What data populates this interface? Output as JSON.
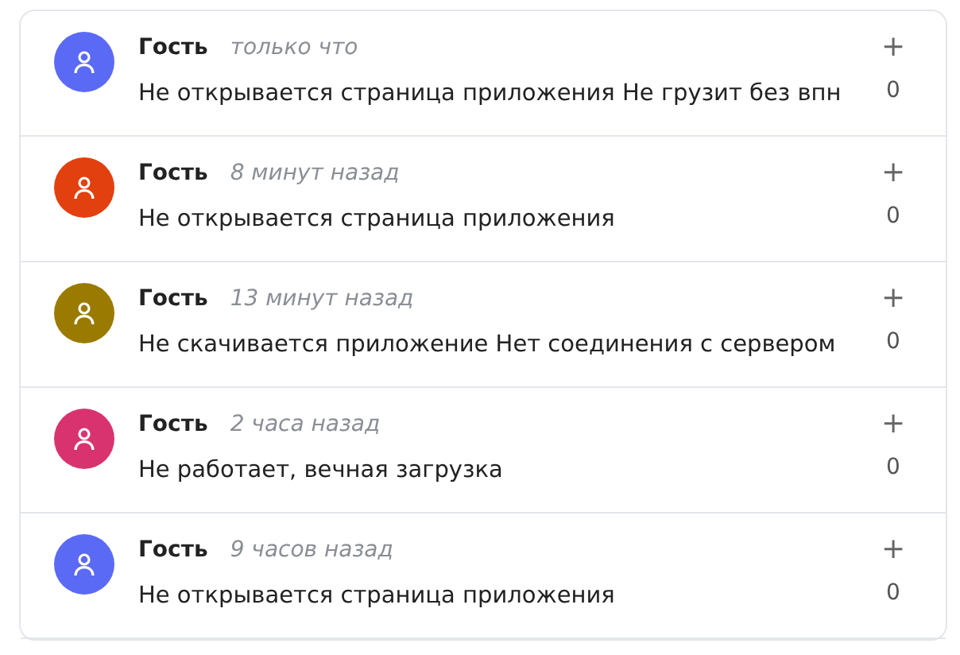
{
  "comments": [
    {
      "author": "Гость",
      "time": "только что",
      "text": "Не открывается страница приложения Не грузит без впн",
      "plus": "+",
      "votes": "0",
      "color": "#5b6af5"
    },
    {
      "author": "Гость",
      "time": "8 минут назад",
      "text": "Не открывается страница приложения",
      "plus": "+",
      "votes": "0",
      "color": "#e2400f"
    },
    {
      "author": "Гость",
      "time": "13 минут назад",
      "text": "Не скачивается приложение Нет соединения с сервером",
      "plus": "+",
      "votes": "0",
      "color": "#9a7a00"
    },
    {
      "author": "Гость",
      "time": "2 часа назад",
      "text": "Не работает, вечная загрузка",
      "plus": "+",
      "votes": "0",
      "color": "#d9336f"
    },
    {
      "author": "Гость",
      "time": "9 часов назад",
      "text": "Не открывается страница приложения",
      "plus": "+",
      "votes": "0",
      "color": "#5b6af5"
    }
  ]
}
